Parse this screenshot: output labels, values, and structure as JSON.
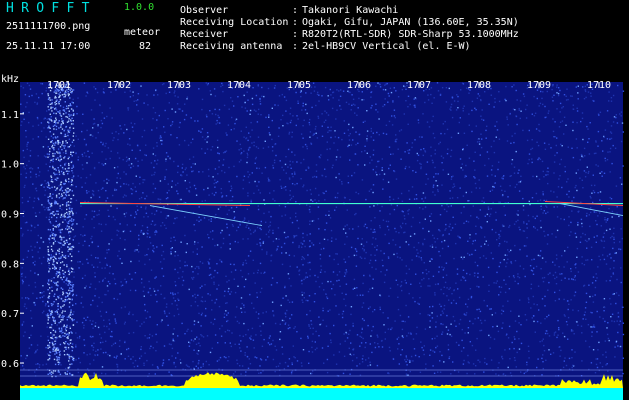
{
  "header": {
    "app_title": "HROFFT",
    "app_version": "1.0.0",
    "file_name": "2511111700.png",
    "datetime": "25.11.11 17:00",
    "mode": "meteor",
    "count": "82",
    "info": [
      {
        "label": "Observer",
        "value": "Takanori Kawachi"
      },
      {
        "label": "Receiving Location",
        "value": "Ogaki, Gifu, JAPAN (136.60E, 35.35N)"
      },
      {
        "label": "Receiver",
        "value": "R820T2(RTL-SDR) SDR-Sharp 53.1000MHz"
      },
      {
        "label": "Receiving antenna",
        "value": "2el-HB9CV Vertical (el. E-W)"
      }
    ]
  },
  "chart_data": {
    "type": "heatmap",
    "ylabel": "kHz",
    "ylim": [
      0.58,
      1.2
    ],
    "yticks": [
      {
        "label": "1.1",
        "v": 1.1
      },
      {
        "label": "1.0",
        "v": 1.0
      },
      {
        "label": "0.9",
        "v": 0.9
      },
      {
        "label": "0.8",
        "v": 0.8
      },
      {
        "label": "0.7",
        "v": 0.7
      },
      {
        "label": "0.6",
        "v": 0.6
      }
    ],
    "xlim": [
      1700,
      1710
    ],
    "xticks": [
      {
        "label": "1701",
        "v": 1701
      },
      {
        "label": "1702",
        "v": 1702
      },
      {
        "label": "1703",
        "v": 1703
      },
      {
        "label": "1704",
        "v": 1704
      },
      {
        "label": "1705",
        "v": 1705
      },
      {
        "label": "1706",
        "v": 1706
      },
      {
        "label": "1707",
        "v": 1707
      },
      {
        "label": "1708",
        "v": 1708
      },
      {
        "label": "1709",
        "v": 1709
      },
      {
        "label": "1710",
        "v": 1710
      }
    ],
    "carrier_khz": 0.92,
    "colors": {
      "background": "#0a1480",
      "noise": "#3050e0",
      "trace": "#40ffd0",
      "hot": "#ff4040",
      "signal_strength": "#ffff00",
      "baseline": "#00ffff",
      "axis_text": "#ffffff"
    }
  }
}
